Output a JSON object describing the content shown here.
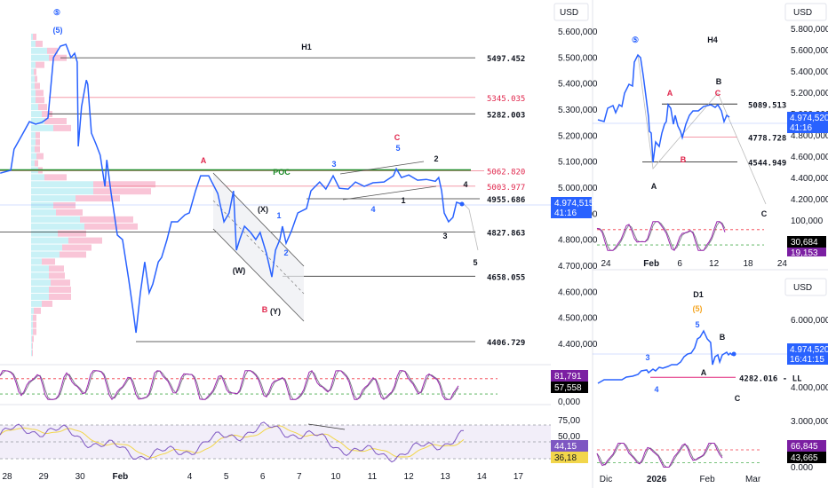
{
  "colors": {
    "price": "#2962ff",
    "red": "#e0264c",
    "green": "#1e8c2a",
    "tag_blue": "#2962ff",
    "stoch_k": "#9c27b0",
    "stoch_d": "#787b86",
    "rsi": "#7e57c2",
    "rsi_ma": "#f2d64b",
    "orange": "#f5a623"
  },
  "main": {
    "timeframe": "H1",
    "currency": "USD",
    "price_tag": {
      "price": "4.974,515",
      "countdown": "41:16"
    },
    "axis_labels": [
      {
        "v": 5600,
        "t": "5.600,000"
      },
      {
        "v": 5500,
        "t": "5.500,000"
      },
      {
        "v": 5400,
        "t": "5.400,000"
      },
      {
        "v": 5300,
        "t": "5.300,000"
      },
      {
        "v": 5200,
        "t": "5.200,000"
      },
      {
        "v": 5100,
        "t": "5.100,000"
      },
      {
        "v": 5000,
        "t": "5.000,000"
      },
      {
        "v": 4900,
        "t": "4.900,000"
      },
      {
        "v": 4800,
        "t": "4.800,000"
      },
      {
        "v": 4700,
        "t": "4.700,000"
      },
      {
        "v": 4600,
        "t": "4.600,000"
      },
      {
        "v": 4500,
        "t": "4.500,000"
      },
      {
        "v": 4400,
        "t": "4.400,000"
      }
    ],
    "levels": [
      {
        "label": "5497.452",
        "price": 5497.452,
        "color": "black"
      },
      {
        "label": "5345.035",
        "price": 5345.035,
        "color": "red"
      },
      {
        "label": "5282.003",
        "price": 5282.003,
        "color": "black"
      },
      {
        "label": "5062.820",
        "price": 5062.82,
        "color": "red"
      },
      {
        "label": "5003.977",
        "price": 5003.977,
        "color": "red"
      },
      {
        "label": "4955.686",
        "price": 4955.686,
        "color": "black"
      },
      {
        "label": "4827.863",
        "price": 4827.863,
        "color": "black"
      },
      {
        "label": "4658.055",
        "price": 4658.055,
        "color": "black"
      },
      {
        "label": "4406.729",
        "price": 4406.729,
        "color": "black"
      }
    ],
    "poc_label": "POC",
    "annotations": {
      "circled5": "⑤",
      "paren5": "(5)",
      "A": "A",
      "C": "C",
      "B": "B",
      "w3": "3",
      "w5": "5",
      "w2": "2",
      "w4": "4",
      "w1": "1",
      "w4b": "4",
      "X": "(X)",
      "w1b": "1",
      "w2b": "2",
      "W": "(W)",
      "Y": "(Y)",
      "w3b": "3",
      "w5b": "5"
    },
    "x_ticks": [
      "28",
      "29",
      "30",
      "Feb",
      "4",
      "5",
      "6",
      "7",
      "10",
      "11",
      "12",
      "13",
      "14",
      "17"
    ],
    "stoch": {
      "k": "81,791",
      "d": "57,558",
      "zero": "0,000"
    },
    "rsi": {
      "level75": "75,00",
      "level50": "50,00",
      "value": "44,15",
      "ma": "36,18"
    }
  },
  "h4": {
    "timeframe": "H4",
    "currency": "USD",
    "price_tag": {
      "price": "4.974,520",
      "countdown": "41:16"
    },
    "axis_labels": [
      {
        "v": 5800,
        "t": "5.800,000"
      },
      {
        "v": 5600,
        "t": "5.600,000"
      },
      {
        "v": 5400,
        "t": "5.400,000"
      },
      {
        "v": 5200,
        "t": "5.200,000"
      },
      {
        "v": 5000,
        "t": "5.000,000"
      },
      {
        "v": 4800,
        "t": "4.800,000"
      },
      {
        "v": 4600,
        "t": "4.600,000"
      },
      {
        "v": 4400,
        "t": "4.400,000"
      },
      {
        "v": 4200,
        "t": "4.200,000"
      }
    ],
    "levels": [
      {
        "label": "5089.513",
        "price": 5089.513,
        "color": "black"
      },
      {
        "label": "4778.728",
        "price": 4778.728,
        "color": "red"
      },
      {
        "label": "4544.949",
        "price": 4544.949,
        "color": "black"
      }
    ],
    "annotations": {
      "circled5": "⑤",
      "B": "B",
      "A_red": "A",
      "C_red": "C",
      "B_red": "B",
      "A": "A",
      "C": "C"
    },
    "x_ticks": [
      "24",
      "Feb",
      "6",
      "12",
      "18",
      "24"
    ],
    "stoch": {
      "top": "100,000",
      "k": "30,684",
      "d": "19,153"
    }
  },
  "d1": {
    "timeframe": "D1",
    "currency": "USD",
    "price_tag": {
      "price": "4.974,520",
      "countdown": "16:41:15"
    },
    "axis_labels": [
      {
        "v": 6000,
        "t": "6.000,000"
      },
      {
        "v": 4000,
        "t": "4.000,000"
      },
      {
        "v": 3000,
        "t": "3.000,000"
      }
    ],
    "level": {
      "label": "4282.016 - LL",
      "price": 4282.016
    },
    "annotations": {
      "paren5": "(5)",
      "w5": "5",
      "B": "B",
      "w3": "3",
      "A": "A",
      "w4": "4",
      "C": "C"
    },
    "x_ticks": [
      "Dic",
      "2026",
      "Feb",
      "Mar"
    ],
    "stoch": {
      "k": "66,845",
      "d": "43,665",
      "zero": "0.000"
    }
  },
  "chart_data": [
    {
      "type": "line",
      "title": "H1",
      "ylabel": "USD",
      "ylim": [
        4350,
        5650
      ],
      "x_unit": "trading day index (28 Jan = 0)",
      "x": [
        -0.19,
        0.1,
        0.19,
        0.41,
        0.61,
        0.78,
        0.95,
        1.12,
        1.27,
        1.46,
        1.61,
        1.75,
        1.85,
        1.92,
        1.95,
        2.04,
        2.17,
        2.21,
        2.31,
        2.43,
        2.55,
        2.68,
        2.73,
        2.85,
        3.02,
        3.16,
        3.33,
        3.45,
        3.53,
        3.65,
        3.77,
        3.89,
        3.99,
        4.14,
        4.23,
        4.38,
        4.5,
        4.67,
        4.87,
        4.99,
        5.16,
        5.3,
        5.52,
        5.77,
        5.94,
        6.08,
        6.2,
        6.28,
        6.37,
        6.5,
        6.67,
        6.81,
        6.93,
        7.1,
        7.25,
        7.35,
        7.47,
        7.54,
        7.64,
        7.79,
        7.96,
        8.2,
        8.32,
        8.56,
        8.73,
        8.93,
        9.1,
        9.34,
        9.54,
        9.78,
        10.02,
        10.32,
        10.58,
        10.66,
        10.8,
        11.0,
        11.24,
        11.48,
        11.73,
        11.82,
        11.9,
        11.97,
        12.09,
        12.21,
        12.31,
        12.46
      ],
      "values": [
        5054,
        5065,
        5146,
        5201,
        5252,
        5242,
        5249,
        5266,
        5498,
        5542,
        5549,
        5498,
        5515,
        5481,
        5157,
        5310,
        5412,
        5395,
        5208,
        5167,
        5123,
        5003,
        5105,
        4976,
        4816,
        4799,
        4645,
        4526,
        4441,
        4594,
        4713,
        4594,
        4628,
        4713,
        4730,
        4799,
        4867,
        4867,
        4894,
        4901,
        4986,
        5044,
        5044,
        4976,
        4867,
        4901,
        4986,
        4758,
        4799,
        4850,
        4826,
        4799,
        4826,
        4747,
        4655,
        4758,
        4799,
        4850,
        4785,
        4833,
        4901,
        4918,
        4986,
        5020,
        4993,
        5044,
        4996,
        4993,
        5020,
        5003,
        5017,
        5020,
        5044,
        5071,
        5037,
        5047,
        5027,
        5030,
        5023,
        5037,
        4986,
        4901,
        4867,
        4884,
        4942,
        4935
      ],
      "volume_profile": {
        "top_price": 5590,
        "row_step": 27,
        "rows": [
          [
            2,
            4
          ],
          [
            5,
            8
          ],
          [
            18,
            12
          ],
          [
            20,
            20
          ],
          [
            5,
            10
          ],
          [
            3,
            3
          ],
          [
            4,
            3
          ],
          [
            4,
            6
          ],
          [
            5,
            9
          ],
          [
            5,
            10
          ],
          [
            8,
            10
          ],
          [
            12,
            12
          ],
          [
            15,
            25
          ],
          [
            25,
            20
          ],
          [
            5,
            5
          ],
          [
            5,
            5
          ],
          [
            4,
            6
          ],
          [
            6,
            8
          ],
          [
            4,
            4
          ],
          [
            8,
            5
          ],
          [
            15,
            25
          ],
          [
            70,
            70
          ],
          [
            70,
            65
          ],
          [
            50,
            50
          ],
          [
            25,
            25
          ],
          [
            28,
            30
          ],
          [
            55,
            60
          ],
          [
            60,
            60
          ],
          [
            30,
            32
          ],
          [
            42,
            38
          ],
          [
            35,
            33
          ],
          [
            32,
            30
          ],
          [
            12,
            15
          ],
          [
            20,
            17
          ],
          [
            20,
            18
          ],
          [
            22,
            22
          ],
          [
            20,
            25
          ],
          [
            20,
            25
          ],
          [
            12,
            12
          ],
          [
            3,
            8
          ],
          [
            2,
            4
          ],
          [
            2,
            4
          ],
          [
            2,
            4
          ],
          [
            1,
            2
          ],
          [
            1,
            1
          ],
          [
            1,
            1
          ]
        ]
      }
    },
    {
      "type": "line",
      "title": "H4",
      "ylabel": "USD",
      "ylim": [
        4100,
        5900
      ],
      "x_unit": "days since 24 Jan",
      "x": [
        -1.41,
        -0.31,
        0.31,
        1.25,
        1.72,
        2.34,
        2.81,
        3.28,
        4.06,
        4.69,
        5.0,
        5.63,
        6.09,
        6.56,
        7.03,
        7.5,
        7.66,
        7.97,
        8.28,
        8.75,
        9.38,
        9.84,
        10.31,
        10.63,
        10.94,
        11.41,
        11.88,
        12.19,
        12.66,
        13.13,
        13.44,
        14.06,
        14.69,
        15.31,
        16.25,
        17.19,
        18.44,
        19.22,
        19.69,
        20.31,
        20.78,
        21.25,
        21.72
      ],
      "values": [
        4942,
        4925,
        5050,
        5075,
        5008,
        5083,
        5067,
        5192,
        5275,
        5258,
        5483,
        5550,
        5525,
        5358,
        5167,
        4967,
        4833,
        4817,
        4542,
        4733,
        4692,
        4817,
        4900,
        4925,
        5083,
        5050,
        4900,
        4983,
        4883,
        4833,
        4775,
        4900,
        4983,
        5025,
        5025,
        5067,
        5083,
        5058,
        5083,
        5025,
        4925,
        4983,
        4967
      ]
    },
    {
      "type": "line",
      "title": "D1",
      "ylabel": "USD",
      "ylim": [
        2800,
        6500
      ],
      "x_unit": "days since 1 Dec",
      "x": [
        -4.9,
        -1.1,
        4.3,
        9.8,
        12.5,
        16.3,
        19.6,
        21.7,
        25,
        26.1,
        28.8,
        30.4,
        32.6,
        34.8,
        38,
        40.2,
        43.5,
        45.7,
        47.8,
        50,
        52.2,
        54.3,
        56,
        57.6,
        59.8,
        62,
        64.1,
        65.2,
        66.8,
        68.5,
        69.6,
        71.2,
        73.9,
        75,
        76.1,
        77.2,
        78.3
      ],
      "values": [
        4105,
        4211,
        4211,
        4211,
        4289,
        4316,
        4368,
        4474,
        4500,
        4421,
        4526,
        4474,
        4579,
        4553,
        4605,
        4658,
        4658,
        4737,
        4895,
        4974,
        5000,
        5158,
        5421,
        5474,
        5658,
        5421,
        5316,
        4658,
        4895,
        4947,
        4737,
        4947,
        5026,
        4947,
        5000,
        4947,
        4974
      ]
    }
  ]
}
